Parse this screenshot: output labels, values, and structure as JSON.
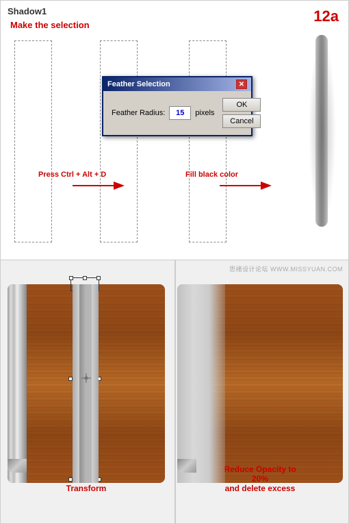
{
  "page": {
    "title": "Shadow1",
    "step": "12a",
    "top_label": "Make the selection",
    "dialog": {
      "title": "Feather Selection",
      "feather_label": "Feather Radius:",
      "feather_value": "15",
      "feather_unit": "pixels",
      "ok_label": "OK",
      "cancel_label": "Cancel"
    },
    "arrow1_label": "Press Ctrl + Alt + D",
    "arrow2_label": "Fill black color",
    "bottom": {
      "watermark": "思绪设计论坛 WWW.MISSYUAN.COM",
      "transform_label": "Transform",
      "opacity_label": "Reduce Opacity to 20%\nand delete excess"
    }
  }
}
